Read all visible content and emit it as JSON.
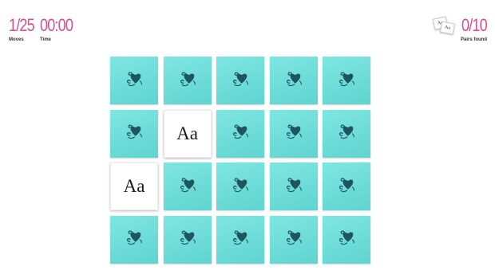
{
  "stats": {
    "moves": {
      "value": "1/25",
      "label": "Moves"
    },
    "time": {
      "value": "00:00",
      "label": "Time"
    },
    "pairs": {
      "value": "0/10",
      "label": "Pairs found"
    }
  },
  "pairs_icon": {
    "icon": "card-pair-icon",
    "card_a": "Aa",
    "card_b": "Aa"
  },
  "board": {
    "rows": 4,
    "cols": 5,
    "back_icon": "leaf-blob-icon",
    "back_color": "#66d9d5",
    "cards": [
      {
        "state": "down"
      },
      {
        "state": "down"
      },
      {
        "state": "down"
      },
      {
        "state": "down"
      },
      {
        "state": "down"
      },
      {
        "state": "down"
      },
      {
        "state": "up",
        "text": "Aa"
      },
      {
        "state": "down"
      },
      {
        "state": "down"
      },
      {
        "state": "down"
      },
      {
        "state": "up",
        "text": "Aa"
      },
      {
        "state": "down"
      },
      {
        "state": "down"
      },
      {
        "state": "down"
      },
      {
        "state": "down"
      },
      {
        "state": "down"
      },
      {
        "state": "down"
      },
      {
        "state": "down"
      },
      {
        "state": "down"
      },
      {
        "state": "down"
      }
    ]
  },
  "colors": {
    "accent": "#d94d8c",
    "card_back": "#66d9d5",
    "icon": "#1f5560"
  }
}
